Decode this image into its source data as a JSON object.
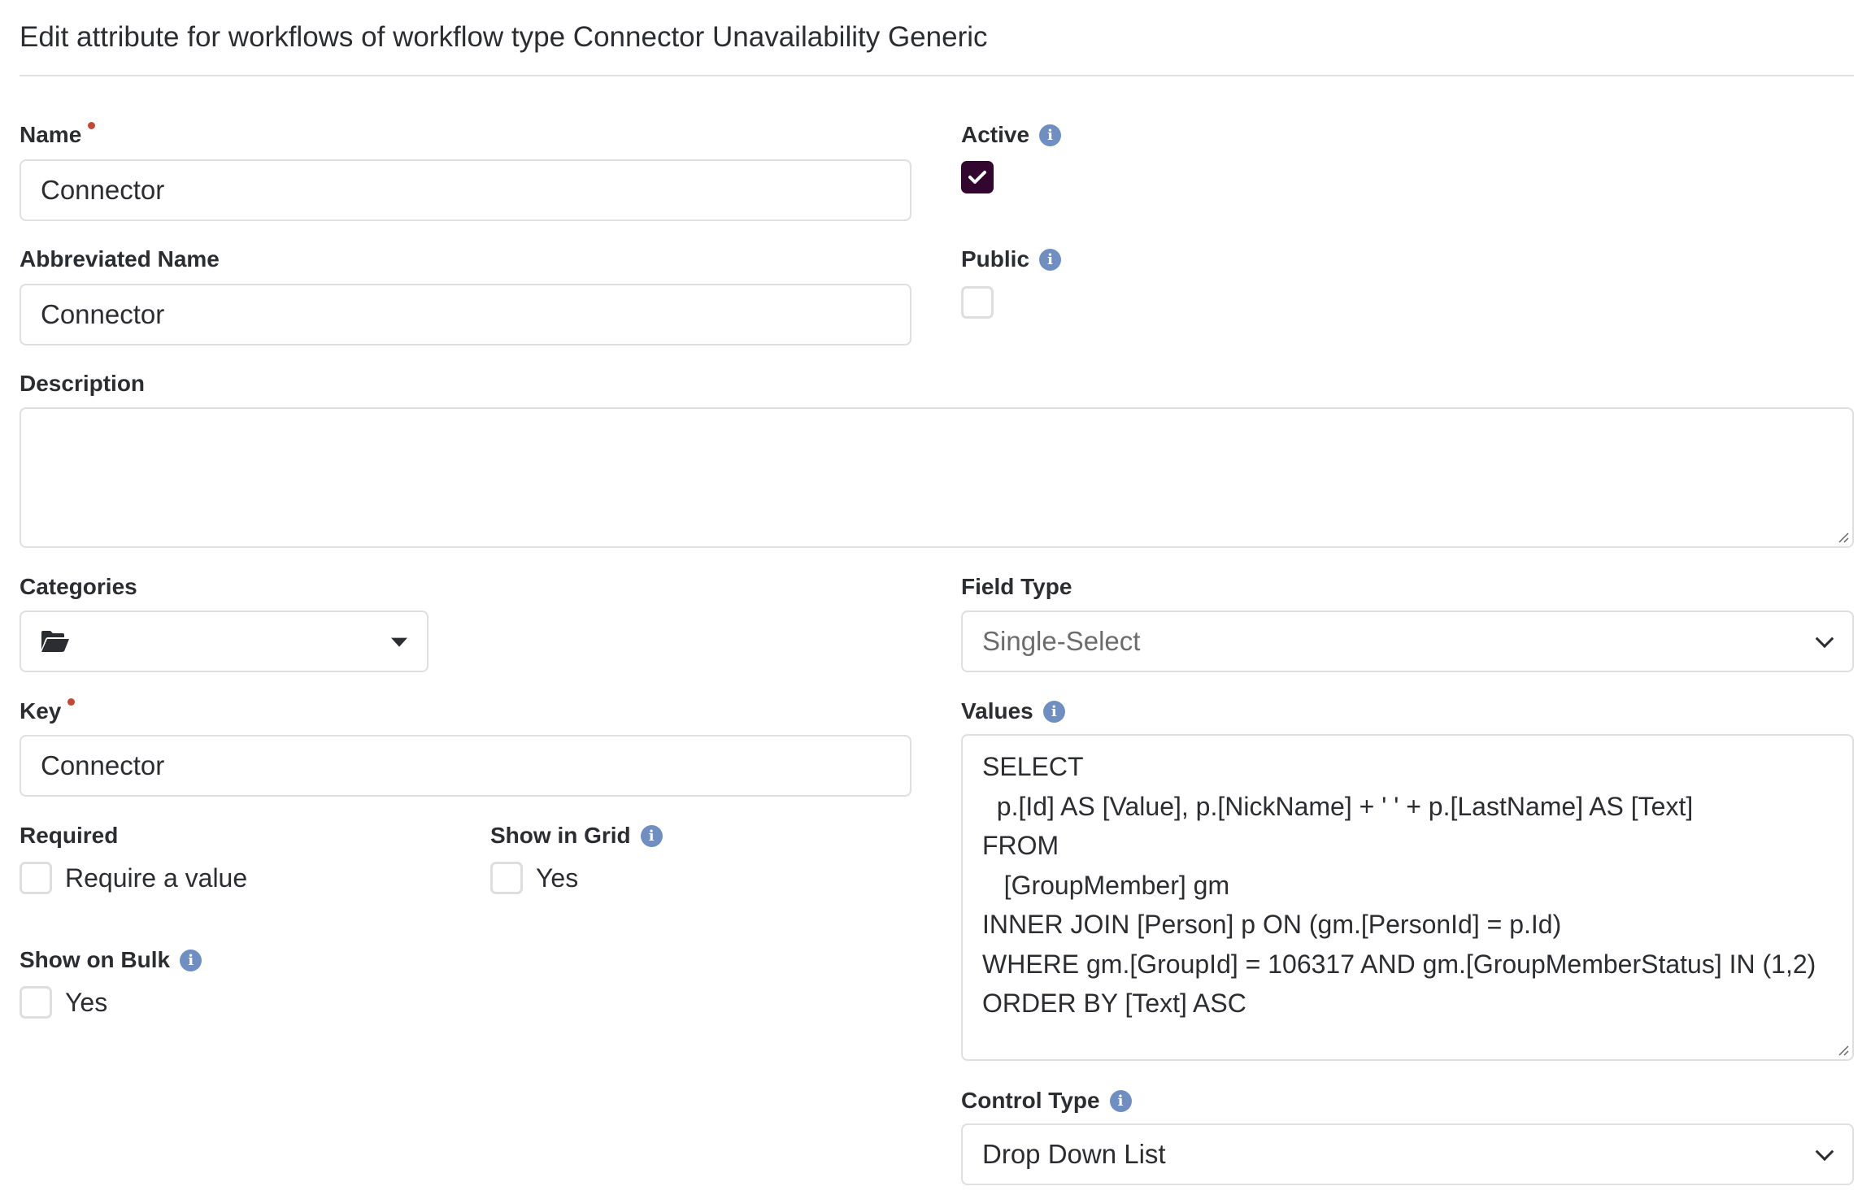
{
  "header": {
    "title": "Edit attribute for workflows of workflow type Connector Unavailability Generic"
  },
  "form": {
    "name": {
      "label": "Name",
      "required": true,
      "value": "Connector"
    },
    "active": {
      "label": "Active",
      "checked": true,
      "info_icon": "info-circle-icon"
    },
    "abbreviated_name": {
      "label": "Abbreviated Name",
      "value": "Connector"
    },
    "public": {
      "label": "Public",
      "checked": false,
      "info_icon": "info-circle-icon"
    },
    "description": {
      "label": "Description",
      "value": ""
    },
    "categories": {
      "label": "Categories",
      "icon": "folder-open-icon",
      "value": ""
    },
    "field_type": {
      "label": "Field Type",
      "value": "Single-Select"
    },
    "key": {
      "label": "Key",
      "required": true,
      "value": "Connector"
    },
    "values": {
      "label": "Values",
      "info_icon": "info-circle-icon",
      "lines": [
        "SELECT",
        "  p.[Id] AS [Value], p.[NickName] + ' ' + p.[LastName] AS [Text]",
        "FROM",
        "   [GroupMember] gm",
        "INNER JOIN [Person] p ON (gm.[PersonId] = p.Id)",
        "WHERE gm.[GroupId] = 106317 AND gm.[GroupMemberStatus] IN (1,2)",
        "ORDER BY [Text] ASC"
      ]
    },
    "required": {
      "label": "Required",
      "option_label": "Require a value",
      "checked": false
    },
    "show_in_grid": {
      "label": "Show in Grid",
      "option_label": "Yes",
      "checked": false,
      "info_icon": "info-circle-icon"
    },
    "show_on_bulk": {
      "label": "Show on Bulk",
      "option_label": "Yes",
      "checked": false,
      "info_icon": "info-circle-icon"
    },
    "control_type": {
      "label": "Control Type",
      "value": "Drop Down List",
      "info_icon": "info-circle-icon"
    }
  },
  "colors": {
    "checkbox_checked": "#33062f",
    "info_icon": "#6f8fc3",
    "required_dot": "#c24a35"
  }
}
